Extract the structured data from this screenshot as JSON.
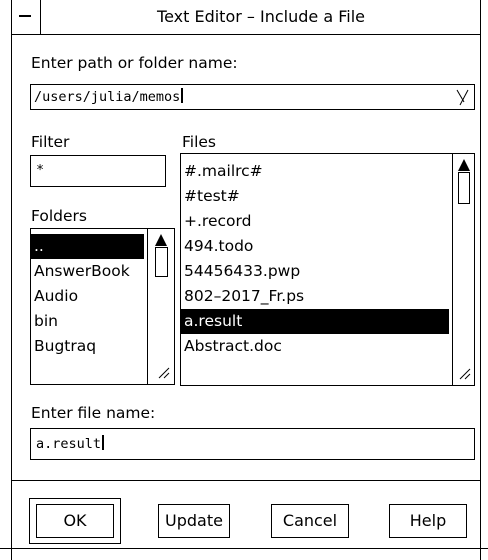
{
  "window": {
    "title": "Text Editor – Include a File"
  },
  "path": {
    "label": "Enter path or folder name:",
    "value": "/users/julia/memos"
  },
  "filter": {
    "label": "Filter",
    "value": "*"
  },
  "files": {
    "label": "Files",
    "items": [
      "#.mailrc#",
      "#test#",
      "+.record",
      "494.todo",
      "54456433.pwp",
      "802–2017_Fr.ps",
      "a.result",
      "Abstract.doc"
    ],
    "selected_index": 6
  },
  "folders": {
    "label": "Folders",
    "items": [
      "..",
      "AnswerBook",
      "Audio",
      "bin",
      "Bugtraq"
    ],
    "selected_index": 0
  },
  "filename": {
    "label": "Enter file name:",
    "value": "a.result"
  },
  "buttons": {
    "ok": "OK",
    "update": "Update",
    "cancel": "Cancel",
    "help": "Help"
  },
  "icons": {
    "window_menu": "window-menu-icon",
    "dropdown": "dropdown-arrow-icon"
  }
}
